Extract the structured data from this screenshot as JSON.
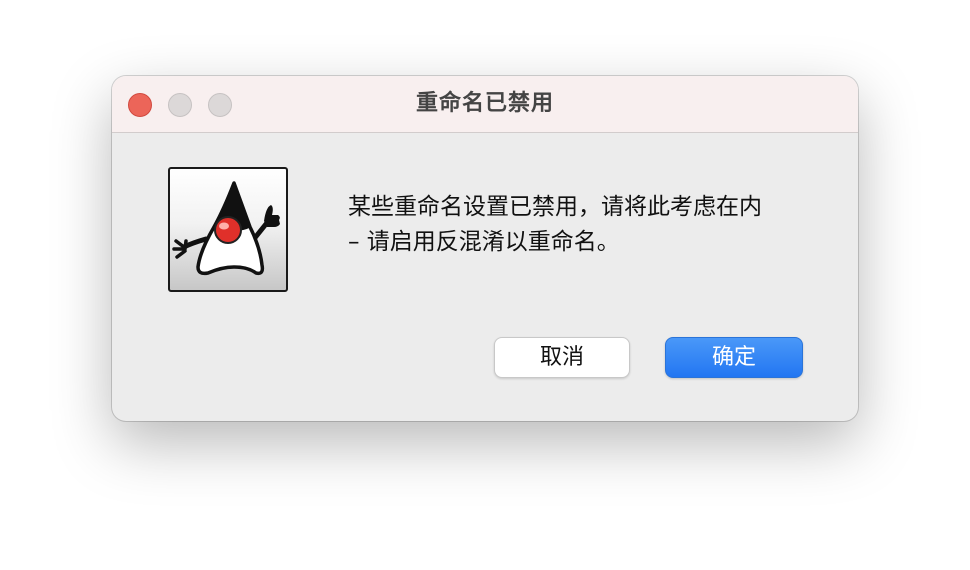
{
  "dialog": {
    "title": "重命名已禁用",
    "icon": "java-duke-icon",
    "message_line1": "某些重命名设置已禁用，请将此考虑在内",
    "message_line2": "– 请启用反混淆以重命名。",
    "cancel_label": "取消",
    "ok_label": "确定"
  },
  "window_controls": {
    "close": "close-icon",
    "minimize": "minimize-icon",
    "maximize": "maximize-icon"
  },
  "colors": {
    "titlebar": "#f8efef",
    "body": "#ececec",
    "close_button": "#ec6559",
    "primary_button": "#2276f2"
  }
}
